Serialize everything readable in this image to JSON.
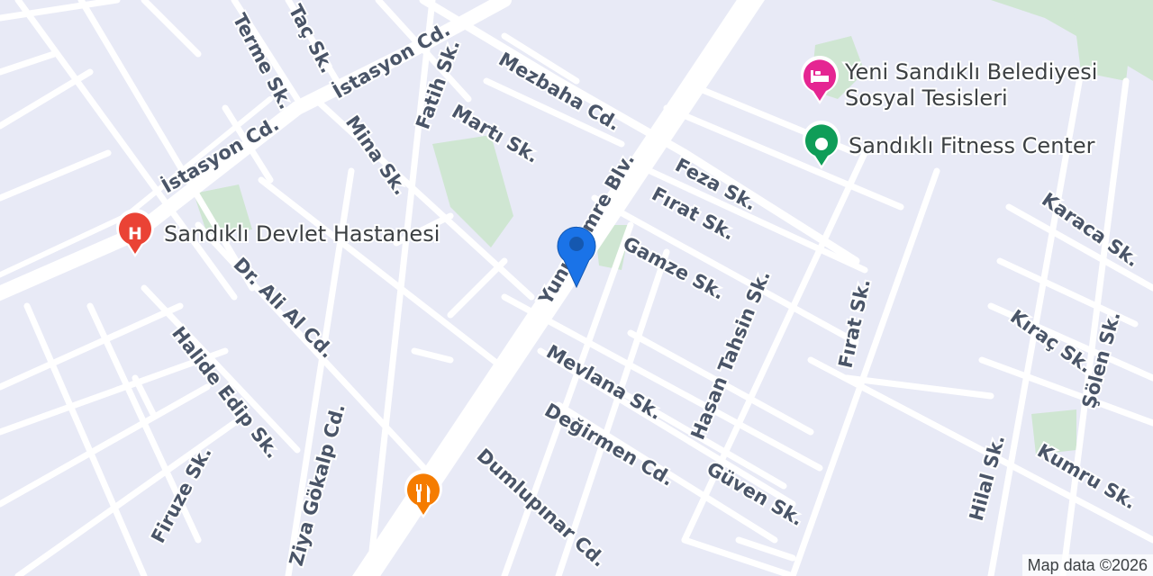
{
  "streets": [
    {
      "id": "istasyon-cd-1",
      "name": "İstasyon Cd."
    },
    {
      "id": "istasyon-cd-2",
      "name": "İstasyon Cd."
    },
    {
      "id": "terme-sk",
      "name": "Terme Sk."
    },
    {
      "id": "tac-sk",
      "name": "Taç Sk."
    },
    {
      "id": "fatih-sk",
      "name": "Fatih Sk."
    },
    {
      "id": "mezbaha-cd",
      "name": "Mezbaha Cd."
    },
    {
      "id": "marti-sk",
      "name": "Martı Sk."
    },
    {
      "id": "mina-sk",
      "name": "Mina Sk."
    },
    {
      "id": "yunus-emre-blv",
      "name": "Yunus Emre Blv."
    },
    {
      "id": "feza-sk",
      "name": "Feza Sk."
    },
    {
      "id": "firat-sk-1",
      "name": "Fırat Sk."
    },
    {
      "id": "gamze-sk",
      "name": "Gamze Sk."
    },
    {
      "id": "karaca-sk",
      "name": "Karaca Sk."
    },
    {
      "id": "hasan-tahsin-sk",
      "name": "Hasan Tahsin Sk."
    },
    {
      "id": "firat-sk-2",
      "name": "Fırat Sk."
    },
    {
      "id": "kirac-sk",
      "name": "Kıraç Sk."
    },
    {
      "id": "solen-sk",
      "name": "Şölen Sk."
    },
    {
      "id": "dr-ali-al-cd",
      "name": "Dr. Ali Al Cd."
    },
    {
      "id": "halide-edip-sk",
      "name": "Halide Edip Sk."
    },
    {
      "id": "mevlana-sk",
      "name": "Mevlana Sk."
    },
    {
      "id": "degirmen-cd",
      "name": "Değirmen Cd."
    },
    {
      "id": "guven-sk",
      "name": "Güven Sk."
    },
    {
      "id": "kumru-sk",
      "name": "Kumru Sk."
    },
    {
      "id": "hilal-sk",
      "name": "Hilal Sk."
    },
    {
      "id": "firuze-sk",
      "name": "Firuze Sk."
    },
    {
      "id": "ziya-gokalp-cd",
      "name": "Ziya Gökalp Cd."
    },
    {
      "id": "dumlupinar-cd",
      "name": "Dumlupınar Cd."
    }
  ],
  "pois": [
    {
      "id": "hospital",
      "name": "Sandıklı Devlet Hastanesi",
      "icon": "hospital-icon",
      "color": "#ea4335",
      "glyph": "H"
    },
    {
      "id": "hotel",
      "name_lines": [
        "Yeni Sandıklı Belediyesi",
        "Sosyal Tesisleri"
      ],
      "icon": "bed-icon",
      "color": "#e52592"
    },
    {
      "id": "fitness",
      "name": "Sandıklı Fitness Center",
      "icon": "fitness-icon",
      "color": "#0f9d58"
    },
    {
      "id": "restaurant",
      "name": "",
      "icon": "restaurant-icon",
      "color": "#f57c00"
    }
  ],
  "location_pin": {
    "icon": "location-pin-icon",
    "color": "#1a73e8"
  },
  "attribution": "Map data ©2026",
  "colors": {
    "background": "#e8eaf6",
    "road": "#ffffff",
    "park": "#cfe6d2",
    "label": "#4a5568"
  }
}
